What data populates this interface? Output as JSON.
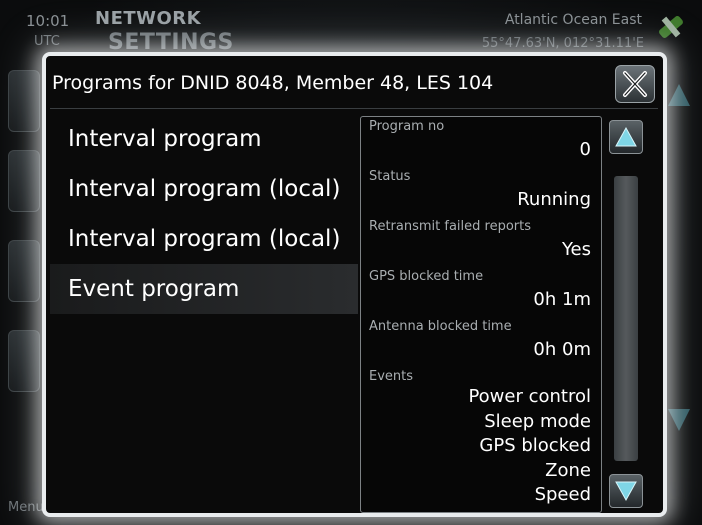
{
  "background": {
    "time": "10:01",
    "timezone": "UTC",
    "title_line1": "NETWORK",
    "title_line2": "SETTINGS",
    "ocean_region": "Atlantic Ocean East",
    "coordinates": "55°47.63'N, 012°31.11'E",
    "menu_label": "Menu"
  },
  "dialog": {
    "title": "Programs for DNID 8048, Member 48, LES 104",
    "close_icon": "close-x-icon"
  },
  "programs": [
    {
      "label": "Interval program",
      "selected": false
    },
    {
      "label": "Interval program (local)",
      "selected": false
    },
    {
      "label": "Interval program (local)",
      "selected": false
    },
    {
      "label": "Event program",
      "selected": true
    }
  ],
  "details": {
    "program_no_label": "Program no",
    "program_no_value": "0",
    "status_label": "Status",
    "status_value": "Running",
    "retransmit_label": "Retransmit failed reports",
    "retransmit_value": "Yes",
    "gps_blocked_label": "GPS blocked time",
    "gps_blocked_value": "0h 1m",
    "antenna_blocked_label": "Antenna blocked time",
    "antenna_blocked_value": "0h 0m",
    "events_label": "Events",
    "events": [
      "Power control",
      "Sleep mode",
      "GPS blocked",
      "Zone",
      "Speed"
    ]
  },
  "colors": {
    "scroll_arrow": "#7fd6e6",
    "dialog_border": "#e9ecee"
  }
}
